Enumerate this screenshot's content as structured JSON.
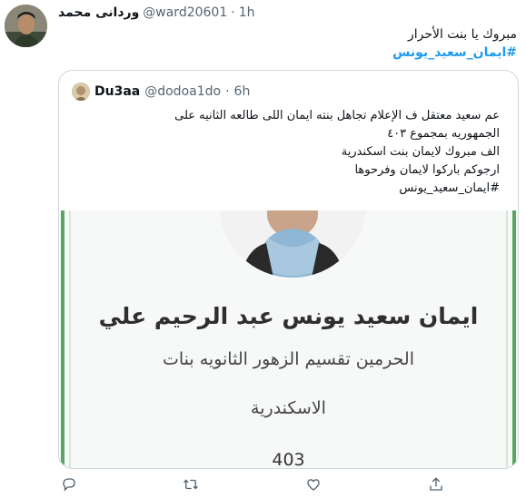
{
  "tweet": {
    "author_name": "وردانى محمد",
    "handle": "@ward20601",
    "separator": "·",
    "time": "1h",
    "text": "مبروك يا بنت الأحرار",
    "hashtag": "#ايمان_سعيد_يونس"
  },
  "quoted": {
    "author_name": "Du3aa",
    "handle": "@dodoa1do",
    "separator": "·",
    "time": "6h",
    "lines": [
      "عم سعيد معتقل ف الإعلام تجاهل بنته ايمان اللى طالعه الثانيه على",
      "الجمهوريه بمجموع ٤٠٣",
      "الف مبروك لايمان بنت اسكندرية",
      "ارجوكم باركوا لايمان وفرحوها",
      "#ايمان_سعيد_يونس"
    ],
    "image": {
      "name": "ايمان سعيد يونس عبد الرحيم علي",
      "school": "الحرمين تقسيم الزهور الثانويه بنات",
      "city": "الاسكندرية",
      "score": "403"
    }
  },
  "actions": {
    "icons": [
      "reply-icon",
      "retweet-icon",
      "like-icon",
      "share-icon"
    ]
  },
  "colors": {
    "accent": "#1d9bf0",
    "muted": "#536471",
    "border": "#cfd9de",
    "frame_green": "#58a760"
  }
}
